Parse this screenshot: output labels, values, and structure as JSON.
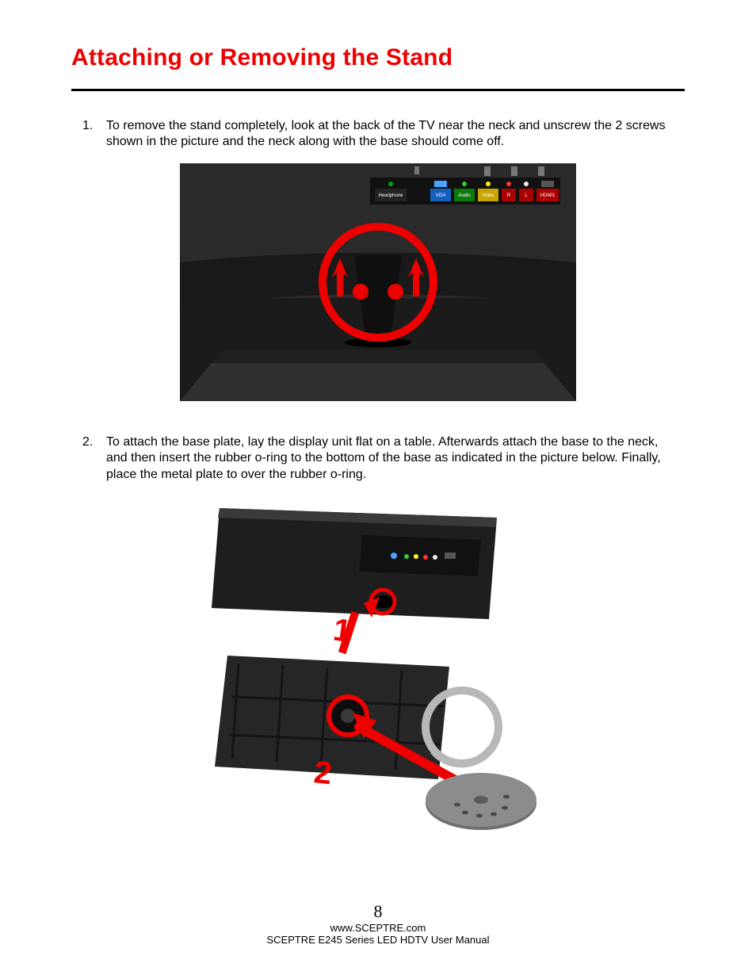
{
  "title": "Attaching or Removing the Stand",
  "steps": [
    {
      "num": "1.",
      "text": "To remove the stand completely, look at the back of the TV near the neck and unscrew the 2 screws shown in the picture and the neck along with the base should come off."
    },
    {
      "num": "2.",
      "text": "To attach the base plate, lay the display unit flat on a table.  Afterwards attach the base to the neck, and then insert the rubber o-ring to the bottom of the base as indicated in the picture below.  Finally, place the metal plate to over the rubber o-ring."
    }
  ],
  "figure1": {
    "ports": {
      "headphone": "Headphone",
      "vga": "VGA",
      "audio": "Audio",
      "video": "Video",
      "r": "R",
      "l": "L",
      "hdmi": "HDMI1"
    }
  },
  "figure2": {
    "label1": "1",
    "label2": "2"
  },
  "footer": {
    "page_number": "8",
    "url": "www.SCEPTRE.com",
    "manual": "SCEPTRE E245 Series LED HDTV User Manual"
  }
}
